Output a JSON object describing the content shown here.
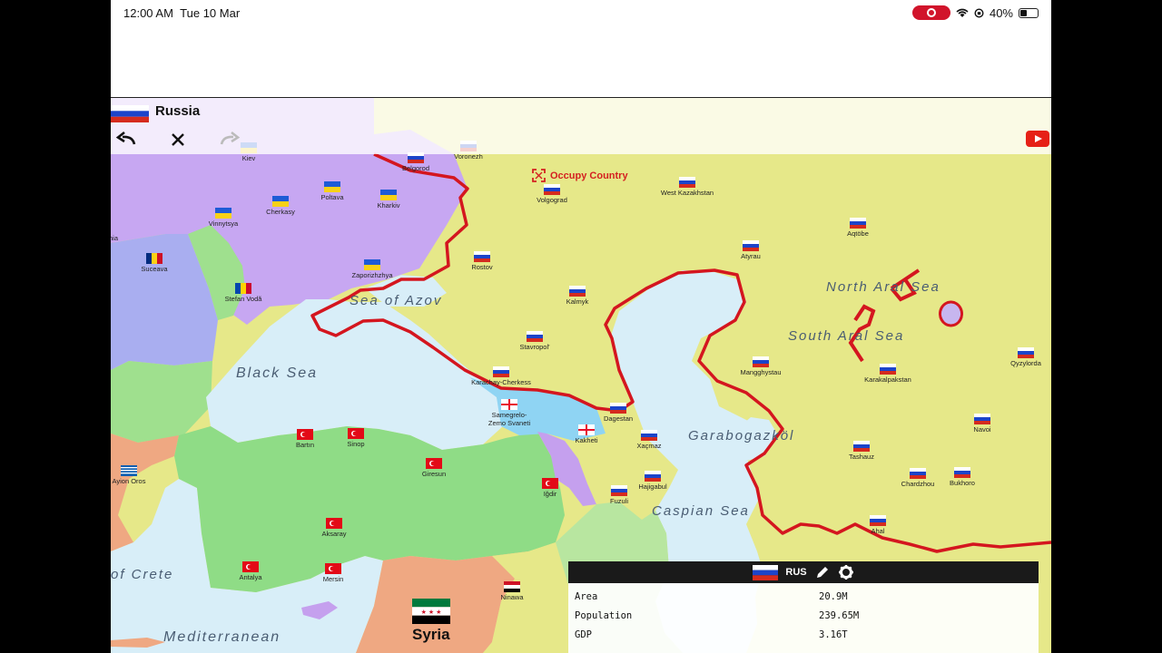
{
  "status_bar": {
    "time": "12:00 AM",
    "date": "Tue 10 Mar",
    "battery": "40%",
    "battery_level": 0.4
  },
  "selected_country": {
    "name": "Russia"
  },
  "toolbar": {
    "undo_icon": "undo-icon",
    "close_icon": "close-icon",
    "redo_icon": "redo-icon",
    "video_icon": "youtube-icon"
  },
  "occupy_label": "Occupy Country",
  "seas": {
    "sea_of_azov": "Sea of Azov",
    "black_sea": "Black Sea",
    "north_aral": "North Aral Sea",
    "south_aral": "South Aral Sea",
    "garabogazkol": "Garabogazköl",
    "caspian": "Caspian Sea",
    "crete": "of Crete",
    "mediterranean": "Mediterranean"
  },
  "regions": {
    "belgorod": "Belgorod",
    "volgograd": "Volgograd",
    "west_kaz": "West Kazakhstan",
    "aqtobe": "Aqtöbe",
    "poltava": "Poltava",
    "cherkasy": "Cherkasy",
    "kharkiv": "Kharkiv",
    "vinnytsya": "Vinnytsya",
    "suceava": "Suceava",
    "stefan_voda": "Stefan Vodă",
    "zaporizhzhya": "Zaporizhzhya",
    "rostov": "Rostov",
    "atyrau": "Atyrau",
    "kalmyk": "Kalmyk",
    "stavropol": "Stavropol'",
    "karachay": "Karachay-Cherkess",
    "samegrelo": "Samegrelo-Zemo Svaneti",
    "dagestan": "Dagestan",
    "kakheti": "Kakheti",
    "xacmaz": "Xaçmaz",
    "hajigabul": "Hajigabul",
    "fuzuli": "Fuzuli",
    "igdir": "Iğdir",
    "mangghystau": "Mangghystau",
    "karakalpakstan": "Karakalpakstan",
    "qyzylorda": "Qyzylorda",
    "navoi": "Navoi",
    "tashauz": "Tashauz",
    "chardzhou": "Chardzhou",
    "bukhoro": "Bukhoro",
    "ahal": "Ahal",
    "bartin": "Bartın",
    "sinop": "Sinop",
    "giresun": "Giresun",
    "aksaray": "Aksaray",
    "antalya": "Antalya",
    "mersin": "Mersin",
    "ninawa": "Ninawa",
    "aylon_oros": "Ayion Oros",
    "kiev": "Kiev",
    "voronezh": "Voronezh",
    "ahia": "hia"
  },
  "syria_label": "Syria",
  "info_panel": {
    "code": "RUS",
    "rows": [
      {
        "label": "Area",
        "value": "20.9M"
      },
      {
        "label": "Population",
        "value": "239.65M"
      },
      {
        "label": "GDP",
        "value": "3.16T"
      }
    ]
  },
  "colors": {
    "russia": "#e6e889",
    "ukraine": "#c7a7f2",
    "romania": "#a9aef0",
    "turkey": "#8fdc86",
    "georgia": "#8fd4f3",
    "armenia": "#c5a0ee",
    "syria": "#efa882",
    "sea": "#d8eef8",
    "border": "#d4161f"
  }
}
